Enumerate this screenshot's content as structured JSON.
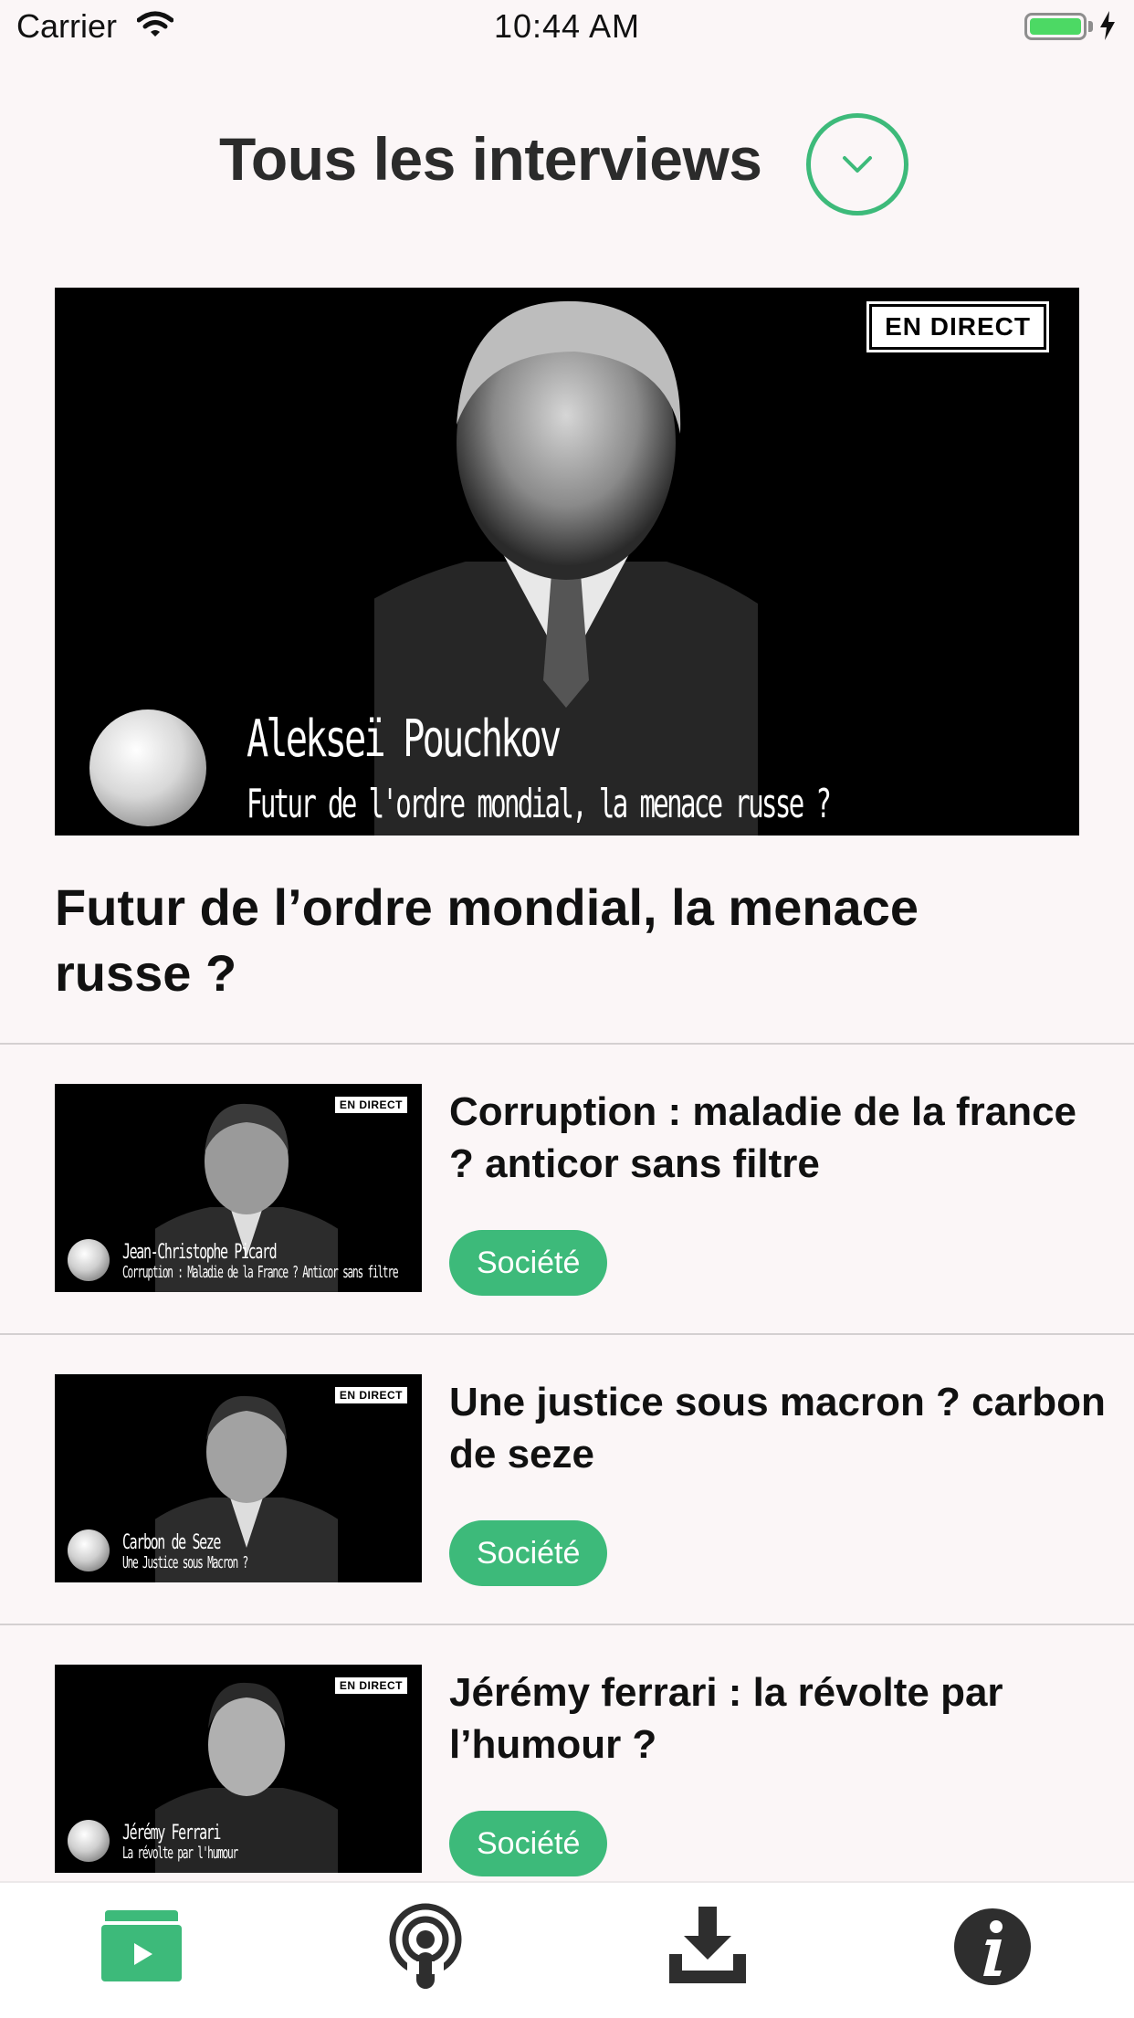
{
  "status_bar": {
    "carrier": "Carrier",
    "time": "10:44 AM"
  },
  "header": {
    "title": "Tous les interviews",
    "dropdown_icon": "chevron-down-icon"
  },
  "featured": {
    "live_badge": "EN DIRECT",
    "overlay_name": "Alekseï Pouchkov",
    "overlay_subtitle": "Futur de l'ordre mondial, la menace russe ?",
    "title": "Futur de l’ordre mondial, la menace russe ?"
  },
  "items": [
    {
      "thumb_badge": "EN DIRECT",
      "thumb_name": "Jean-Christophe Picard",
      "thumb_subtitle": "Corruption : Maladie de la France ? Anticor sans filtre",
      "title": "Corruption : maladie de la france ? anticor sans filtre",
      "tag": "Société"
    },
    {
      "thumb_badge": "EN DIRECT",
      "thumb_name": "Carbon de Seze",
      "thumb_subtitle": "Une Justice sous Macron ?",
      "title": "Une justice sous macron ? carbon de seze",
      "tag": "Société"
    },
    {
      "thumb_badge": "EN DIRECT",
      "thumb_name": "Jérémy Ferrari",
      "thumb_subtitle": "La révolte par l'humour",
      "title": "Jérémy ferrari : la révolte par l’humour ?",
      "tag": "Société"
    }
  ],
  "tab_bar": {
    "tabs": [
      {
        "icon": "video-folder-icon",
        "active": true
      },
      {
        "icon": "podcast-icon",
        "active": false
      },
      {
        "icon": "download-icon",
        "active": false
      },
      {
        "icon": "info-icon",
        "active": false
      }
    ]
  },
  "colors": {
    "accent": "#3dba7a",
    "background": "#fbf6f7",
    "title_text": "#2b2b2b",
    "tab_inactive": "#2e2e2e"
  }
}
